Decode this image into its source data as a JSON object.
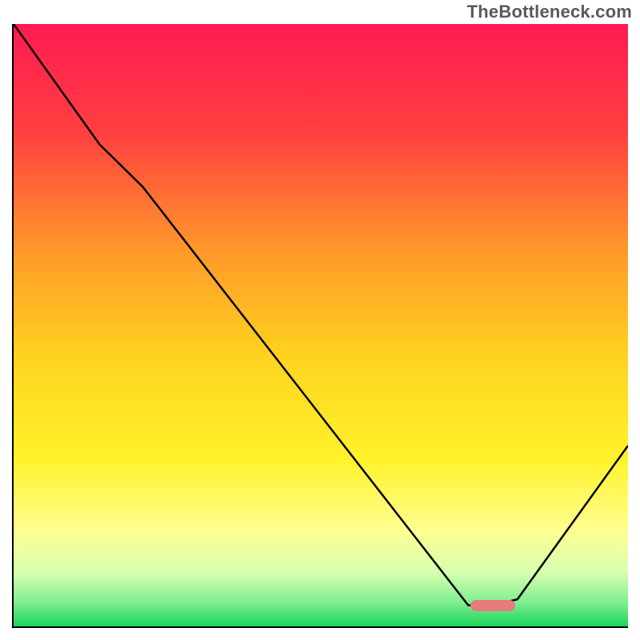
{
  "watermark": "TheBottleneck.com",
  "colors": {
    "gradient_stops": [
      {
        "pct": 0,
        "hex": "#ff1b53"
      },
      {
        "pct": 18,
        "hex": "#ff4040"
      },
      {
        "pct": 38,
        "hex": "#ff9a2a"
      },
      {
        "pct": 55,
        "hex": "#ffd21f"
      },
      {
        "pct": 72,
        "hex": "#fff22a"
      },
      {
        "pct": 84,
        "hex": "#ffff90"
      },
      {
        "pct": 91,
        "hex": "#d8ffb0"
      },
      {
        "pct": 96,
        "hex": "#7fef8f"
      },
      {
        "pct": 100,
        "hex": "#18d55b"
      }
    ],
    "line": "#000000",
    "marker": "#e77b7d"
  },
  "chart_data": {
    "type": "line",
    "title": "",
    "xlabel": "",
    "ylabel": "",
    "xlim": [
      0,
      100
    ],
    "ylim": [
      0,
      100
    ],
    "grid": false,
    "series": [
      {
        "name": "bottleneck-curve",
        "x": [
          0,
          14,
          21,
          74,
          78,
          82,
          100
        ],
        "y": [
          100,
          80,
          73,
          3.5,
          3.5,
          4.5,
          30
        ]
      }
    ],
    "annotations": [
      {
        "name": "optimum-marker",
        "x": 78,
        "y": 3.5
      }
    ]
  }
}
